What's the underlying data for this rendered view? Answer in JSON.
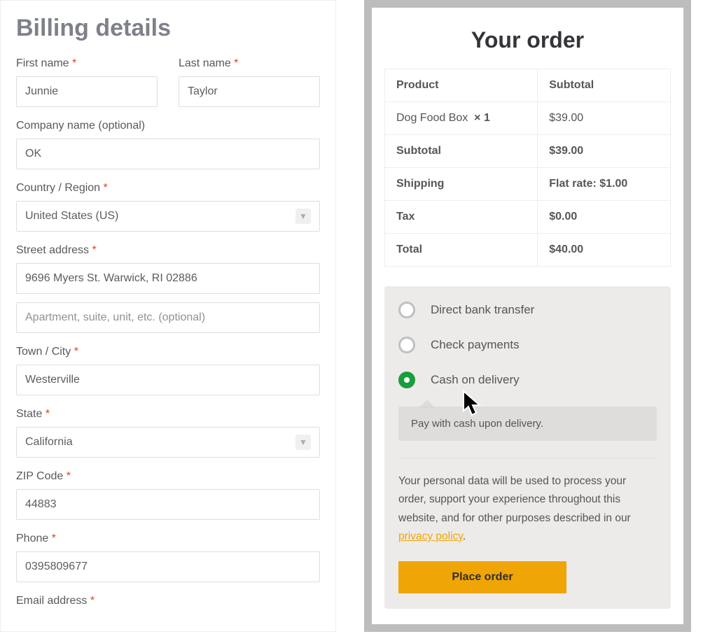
{
  "billing": {
    "heading": "Billing details",
    "first_name_label": "First name",
    "first_name": "Junnie",
    "last_name_label": "Last name",
    "last_name": "Taylor",
    "company_label": "Company name (optional)",
    "company": "OK",
    "country_label": "Country / Region",
    "country": "United States (US)",
    "street_label": "Street address",
    "street1": "9696 Myers St. Warwick, RI 02886",
    "street2_placeholder": "Apartment, suite, unit, etc. (optional)",
    "city_label": "Town / City",
    "city": "Westerville",
    "state_label": "State",
    "state": "California",
    "zip_label": "ZIP Code",
    "zip": "44883",
    "phone_label": "Phone",
    "phone": "0395809677",
    "email_label": "Email address"
  },
  "order": {
    "heading": "Your order",
    "product_col": "Product",
    "subtotal_col": "Subtotal",
    "item_name": "Dog Food Box",
    "item_qty": "× 1",
    "item_price": "$39.00",
    "subtotal_label": "Subtotal",
    "subtotal_value": "$39.00",
    "shipping_label": "Shipping",
    "shipping_value": "Flat rate: $1.00",
    "tax_label": "Tax",
    "tax_value": "$0.00",
    "total_label": "Total",
    "total_value": "$40.00"
  },
  "payment": {
    "opt1": "Direct bank transfer",
    "opt2": "Check payments",
    "opt3": "Cash on delivery",
    "desc": "Pay with cash upon delivery.",
    "privacy_text": "Your personal data will be used to process your order, support your experience throughout this website, and for other purposes described in our ",
    "privacy_link_text": "privacy policy",
    "place_order": "Place order"
  }
}
